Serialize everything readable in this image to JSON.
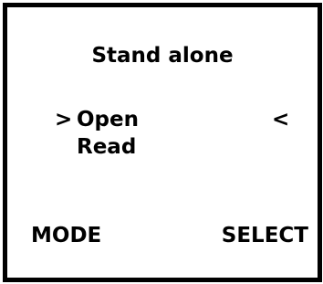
{
  "screen": {
    "title": "Stand alone"
  },
  "menu": {
    "cursor_left": ">",
    "cursor_right": "<",
    "items": [
      {
        "label": "Open",
        "selected": true
      },
      {
        "label": "Read",
        "selected": false
      }
    ]
  },
  "softkeys": {
    "left_label": "MODE",
    "right_label": "SELECT"
  }
}
